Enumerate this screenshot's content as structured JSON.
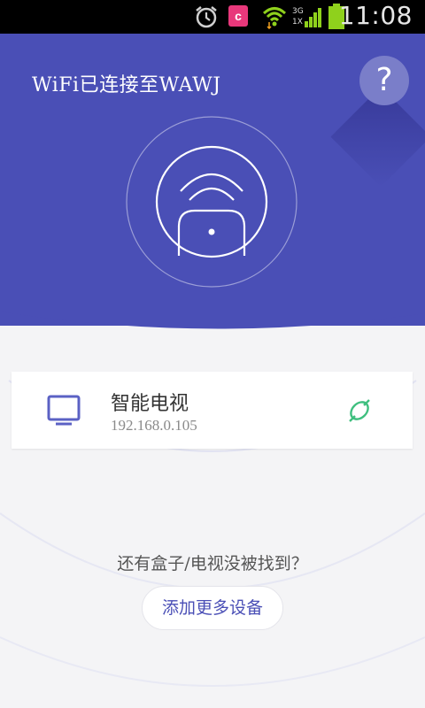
{
  "status_bar": {
    "time": "11:08",
    "app_badge": "c",
    "network_labels": [
      "3G",
      "1X"
    ],
    "icons": [
      "alarm-icon",
      "app-notification-icon",
      "wifi-icon",
      "signal-icon",
      "battery-icon"
    ]
  },
  "header": {
    "title": "WiFi已连接至WAWJ",
    "help_label": "?",
    "accent_color": "#4a4fb6"
  },
  "device": {
    "name": "智能电视",
    "ip": "192.168.0.105",
    "icon": "tv-icon",
    "status_icon": "link-icon",
    "status_color": "#3fbf7f"
  },
  "footer": {
    "prompt": "还有盒子/电视没被找到？",
    "add_button_label": "添加更多设备"
  }
}
